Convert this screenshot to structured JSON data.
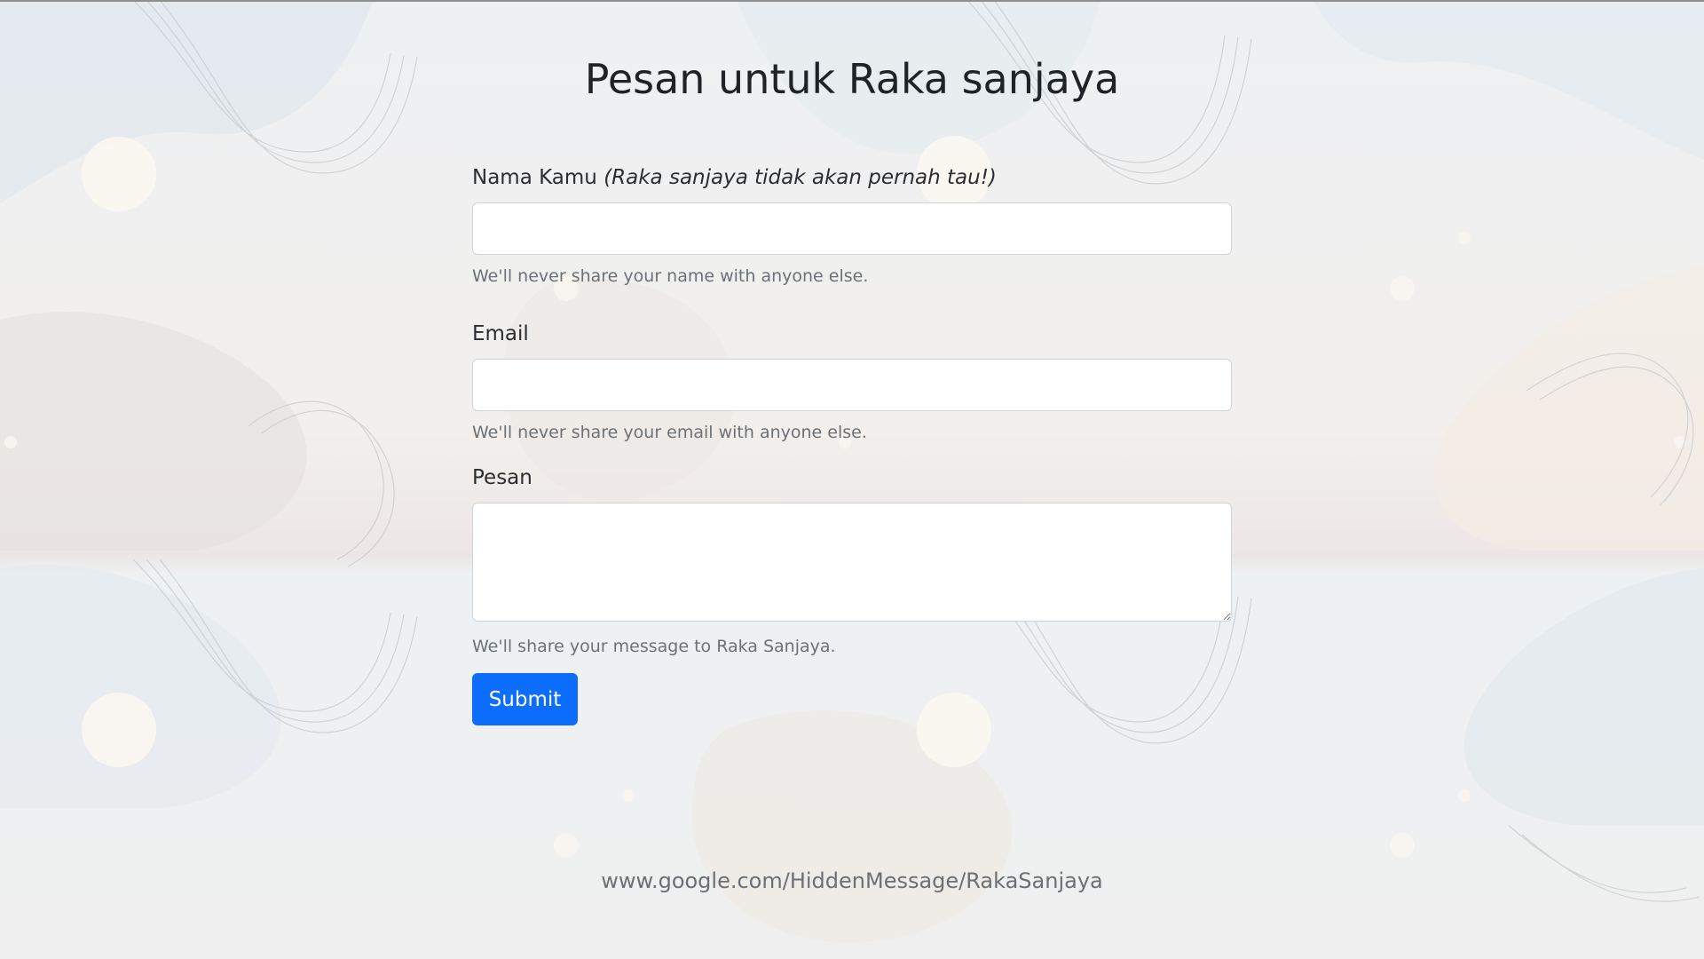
{
  "page": {
    "title": "Pesan untuk Raka sanjaya"
  },
  "form": {
    "name": {
      "label": "Nama Kamu",
      "label_note": "(Raka sanjaya tidak akan pernah tau!)",
      "value": "",
      "help": "We'll never share your name with anyone else."
    },
    "email": {
      "label": "Email",
      "value": "",
      "help": "We'll never share your email with anyone else."
    },
    "message": {
      "label": "Pesan",
      "value": "",
      "help": "We'll share your message to Raka Sanjaya."
    },
    "submit_label": "Submit"
  },
  "footer": {
    "url": "www.google.com/HiddenMessage/RakaSanjaya"
  },
  "colors": {
    "primary_button": "#0d6efd",
    "input_border": "#cfd4da",
    "help_text": "#6b7178"
  }
}
